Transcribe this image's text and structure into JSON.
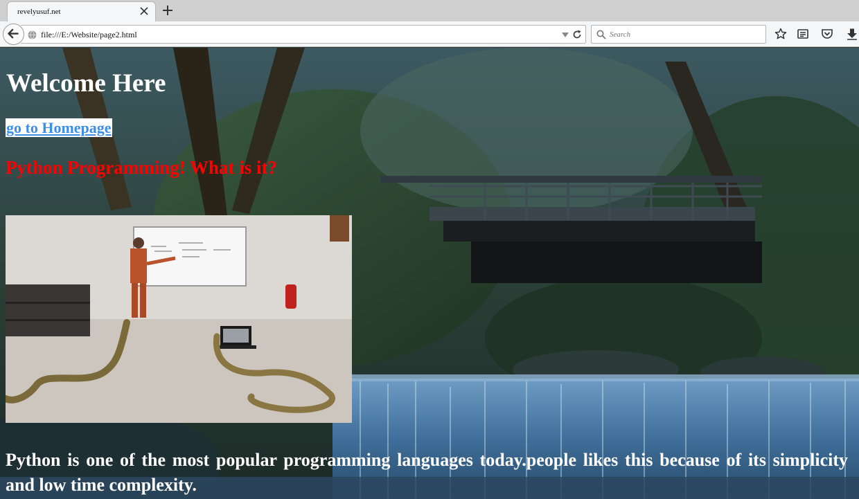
{
  "browser": {
    "tab_title": "revelyusuf.net",
    "url": "file:///E:/Website/page2.html",
    "search_placeholder": "Search"
  },
  "page": {
    "heading": "Welcome Here",
    "home_link": "go to Homepage",
    "subheading": "Python Programming! What is it?",
    "paragraph": "Python is one of the most popular programming languages today.people likes this because of its simplicity and low time complexity.",
    "image_icon": "classroom-snakes-photo",
    "background_icon": "forest-bridge-waterfall-photo"
  },
  "colors": {
    "heading": "#ffffff",
    "link": "#3d8ee8",
    "subheading": "#ff0000"
  }
}
